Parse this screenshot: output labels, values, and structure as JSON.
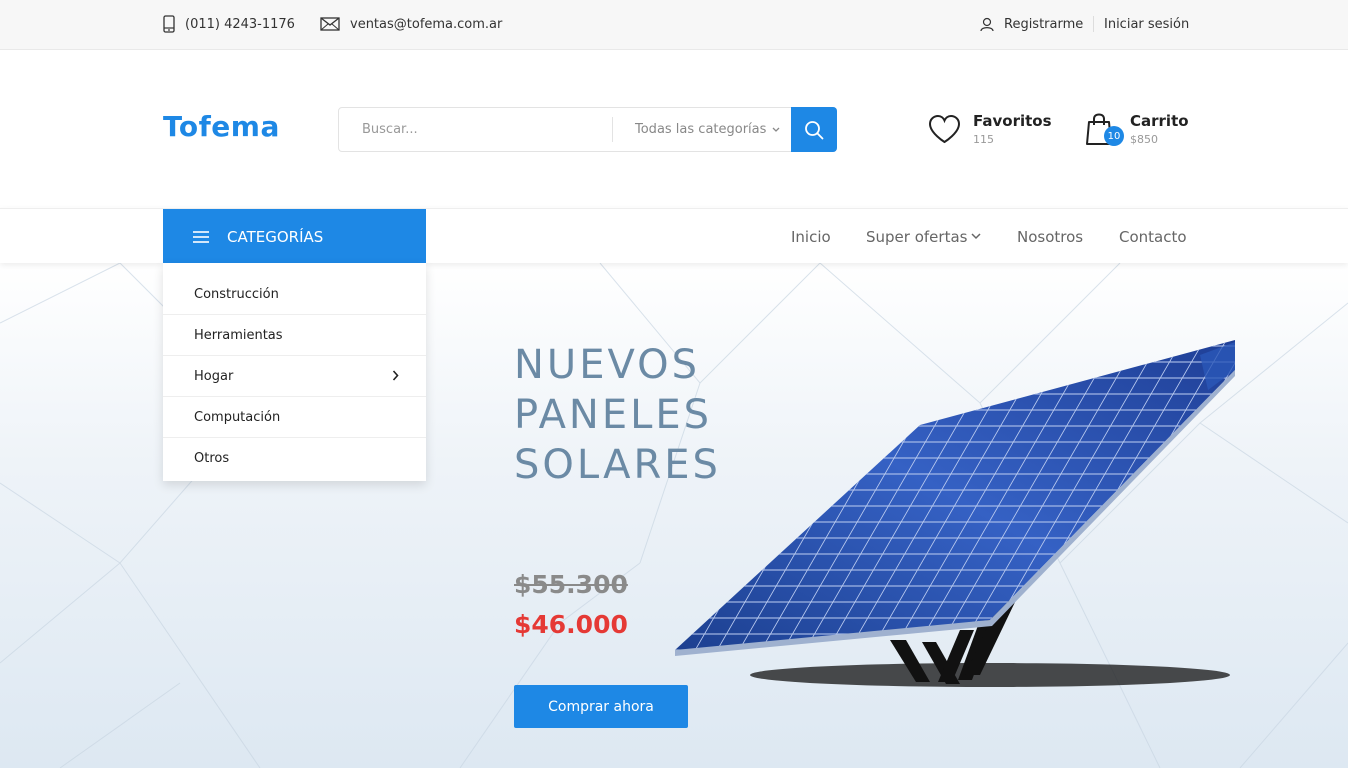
{
  "topbar": {
    "phone": "(011) 4243-1176",
    "email": "ventas@tofema.com.ar",
    "register": "Registrarme",
    "login": "Iniciar sesión"
  },
  "header": {
    "logo": "Tofema",
    "search_placeholder": "Buscar...",
    "category_select": "Todas las categorías",
    "favorites": {
      "label": "Favoritos",
      "count": "115"
    },
    "cart": {
      "label": "Carrito",
      "total": "$850",
      "badge": "10"
    }
  },
  "nav": {
    "categories_button": "CATEGORÍAS",
    "links": [
      "Inicio",
      "Super ofertas",
      "Nosotros",
      "Contacto"
    ]
  },
  "categories": [
    "Construcción",
    "Herramientas",
    "Hogar",
    "Computación",
    "Otros"
  ],
  "hero": {
    "title_lines": [
      "NUEVOS",
      "PANELES",
      "SOLARES"
    ],
    "old_price": "$55.300",
    "new_price": "$46.000",
    "cta": "Comprar ahora"
  },
  "colors": {
    "accent": "#1e88e5",
    "sale": "#e53935",
    "hero_title": "#6b8aa5"
  },
  "icons": [
    "phone-icon",
    "mail-icon",
    "user-icon",
    "heart-icon",
    "bag-icon",
    "search-icon",
    "menu-icon",
    "chevron-down-icon",
    "chevron-right-icon"
  ]
}
